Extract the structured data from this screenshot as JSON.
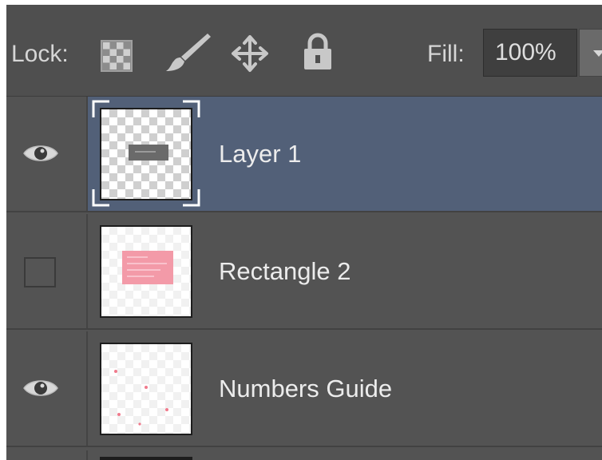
{
  "toolbar": {
    "lock_label": "Lock:",
    "lock_icons": [
      "lock-transparent-pixels-icon",
      "lock-image-pixels-brush-icon",
      "lock-position-move-icon",
      "lock-all-padlock-icon"
    ],
    "fill_label": "Fill:",
    "fill_value": "100%"
  },
  "layers": [
    {
      "name": "Layer 1",
      "visible": true,
      "selected": true
    },
    {
      "name": "Rectangle 2",
      "visible": false,
      "selected": false
    },
    {
      "name": "Numbers Guide",
      "visible": true,
      "selected": false
    }
  ],
  "colors": {
    "panel_bg": "#535353",
    "selected_row": "#526078",
    "text": "#ececec",
    "rectangle_fill": "#f39aa8"
  }
}
